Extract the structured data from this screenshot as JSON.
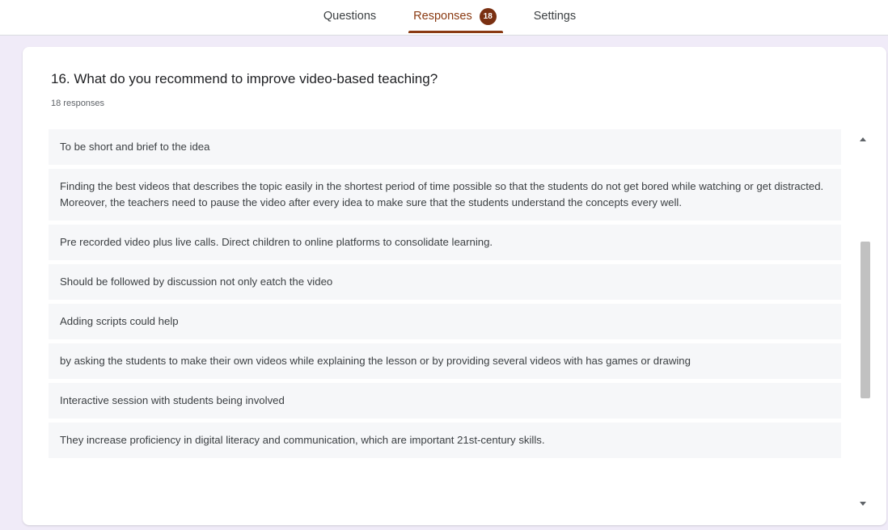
{
  "tabs": [
    {
      "label": "Questions"
    },
    {
      "label": "Responses",
      "badge": "18"
    },
    {
      "label": "Settings"
    }
  ],
  "colors": {
    "accent": "#8a3a12",
    "background": "#f0ebf8"
  },
  "question": {
    "title": "16. What do you recommend to improve video-based teaching?",
    "response_count": "18 responses"
  },
  "responses": [
    "To be short and brief to the idea",
    "Finding the best videos that describes the topic easily in the shortest period of time possible so that the students do not get bored while watching or get distracted. Moreover, the teachers need to pause the video after every idea to make sure that the students understand the concepts every well.",
    "Pre recorded video plus live calls. Direct children to online platforms to consolidate learning.",
    "Should be followed by discussion not only eatch the video",
    "Adding scripts could help",
    "by asking the students to make their own videos while explaining the lesson or by providing several videos with has games or drawing",
    "Interactive session with students being involved",
    "They increase proficiency in digital literacy and communication, which are important 21st-century skills."
  ]
}
